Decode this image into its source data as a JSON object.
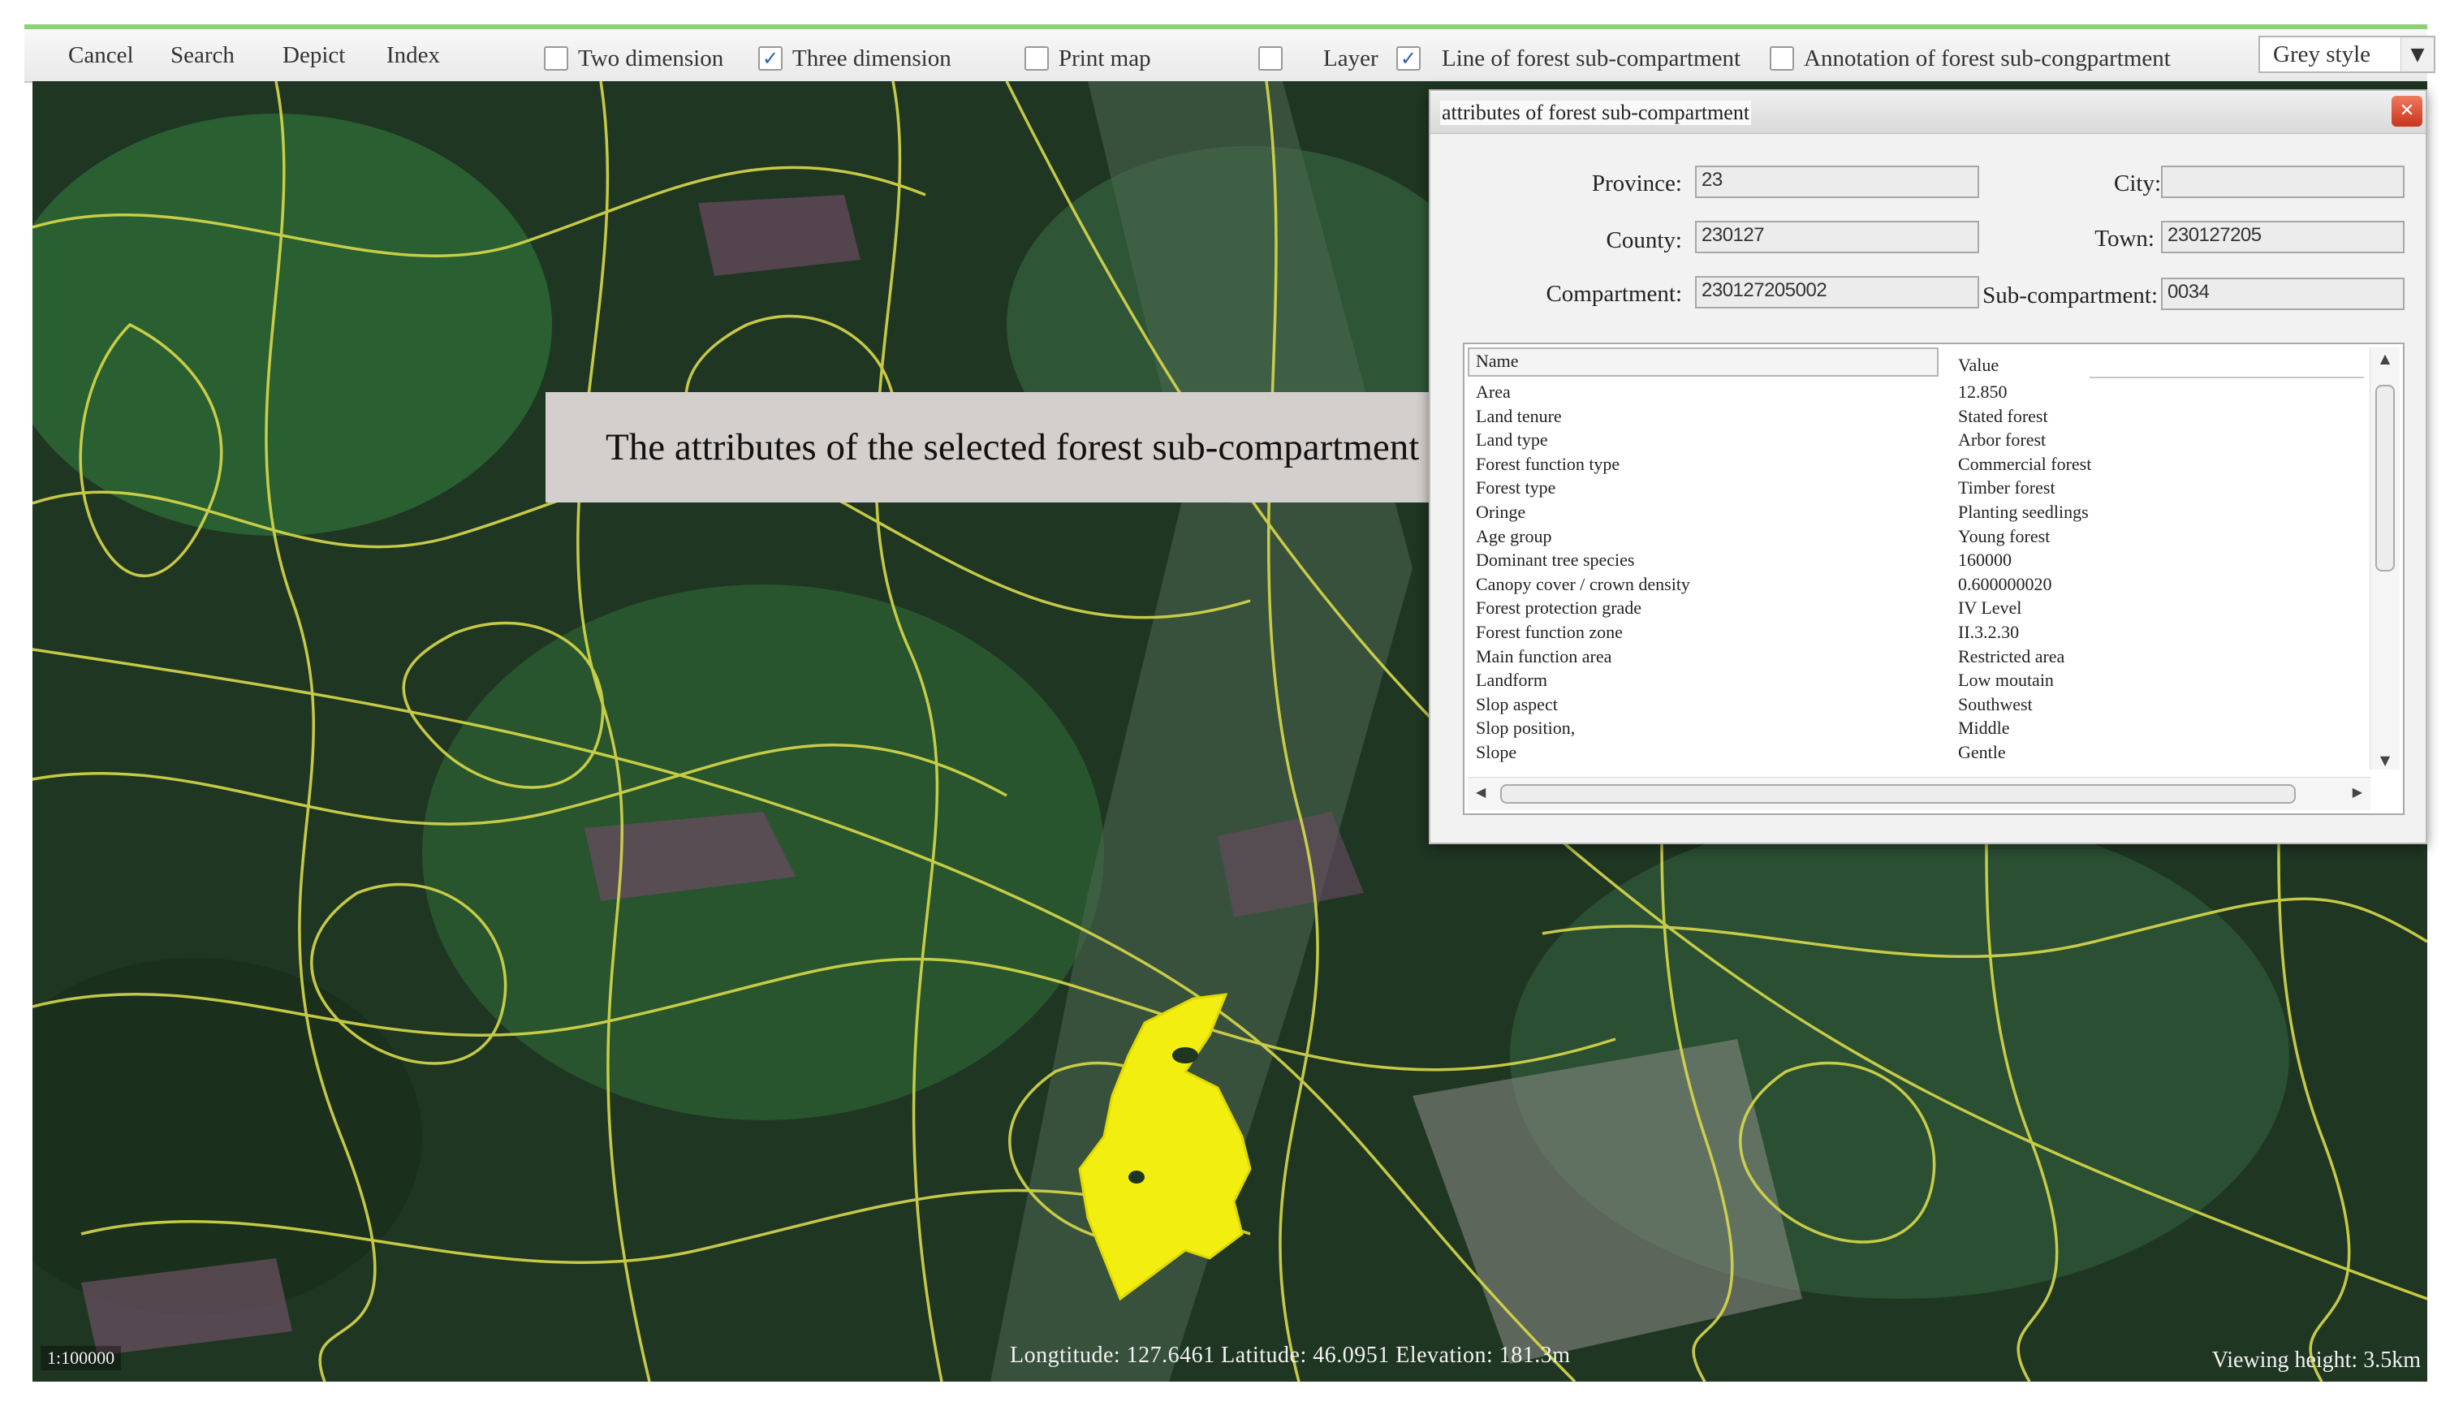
{
  "toolbar": {
    "buttons": [
      "Cancel",
      "Search",
      "Depict",
      "Index"
    ],
    "checkboxes": [
      {
        "label": "Two dimension",
        "checked": false
      },
      {
        "label": "Three dimension",
        "checked": true
      },
      {
        "label": "Print map",
        "checked": false
      },
      {
        "label": "Layer",
        "checked": false
      },
      {
        "label": "Line of forest sub-compartment",
        "checked": true
      },
      {
        "label": "Annotation of forest sub-congpartment",
        "checked": false
      }
    ],
    "style_select": "Grey style"
  },
  "map": {
    "callout": "The attributes of the selected forest sub-compartment",
    "scale": "1:100000",
    "coordinates": "Longtitude: 127.6461   Latitude: 46.0951   Elevation: 181.3m",
    "viewing_height": "Viewing height: 3.5km",
    "colors": {
      "boundary": "#d9d94a",
      "selected": "#f2ee10"
    }
  },
  "dialog": {
    "title": "attributes of forest sub-compartment",
    "fields": {
      "province_label": "Province:",
      "province_value": "23",
      "city_label": "City:",
      "city_value": "",
      "county_label": "County:",
      "county_value": "230127",
      "town_label": "Town:",
      "town_value": "230127205",
      "compartment_label": "Compartment:",
      "compartment_value": "230127205002",
      "subcompartment_label": "Sub-compartment:",
      "subcompartment_value": "0034"
    },
    "table": {
      "name_header": "Name",
      "value_header": "Value",
      "rows": [
        {
          "name": "Area",
          "value": "12.850"
        },
        {
          "name": "Land tenure",
          "value": "Stated forest"
        },
        {
          "name": "Land type",
          "value": "Arbor forest"
        },
        {
          "name": "Forest function type",
          "value": "Commercial forest"
        },
        {
          "name": "Forest type",
          "value": "Timber forest"
        },
        {
          "name": "Oringe",
          "value": "Planting seedlings"
        },
        {
          "name": "Age group",
          "value": "Young forest"
        },
        {
          "name": "Dominant tree species",
          "value": "160000"
        },
        {
          "name": "Canopy cover / crown density",
          "value": "0.600000020"
        },
        {
          "name": "Forest protection grade",
          "value": "IV Level"
        },
        {
          "name": "Forest function zone",
          "value": "II.3.2.30"
        },
        {
          "name": "Main function area",
          "value": "Restricted area"
        },
        {
          "name": "Landform",
          "value": "Low moutain"
        },
        {
          "name": "Slop aspect",
          "value": "Southwest"
        },
        {
          "name": "Slop position,",
          "value": "Middle"
        },
        {
          "name": "Slope",
          "value": "Gentle"
        }
      ]
    }
  }
}
